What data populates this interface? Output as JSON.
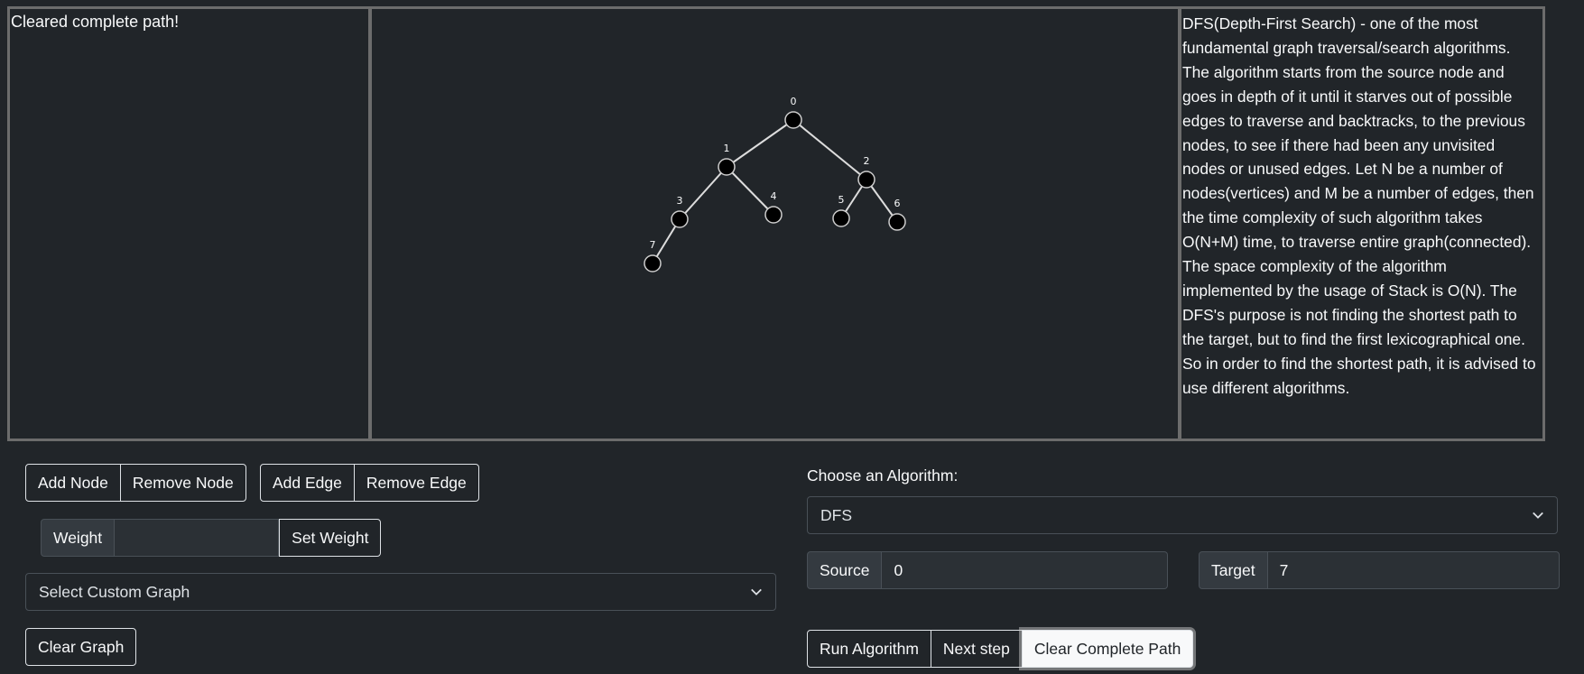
{
  "status": {
    "message": "Cleared complete path!"
  },
  "graph": {
    "nodes": [
      {
        "id": "0",
        "label": "0"
      },
      {
        "id": "1",
        "label": "1"
      },
      {
        "id": "2",
        "label": "2"
      },
      {
        "id": "3",
        "label": "3"
      },
      {
        "id": "4",
        "label": "4"
      },
      {
        "id": "5",
        "label": "5"
      },
      {
        "id": "6",
        "label": "6"
      },
      {
        "id": "7",
        "label": "7"
      }
    ],
    "edges": [
      [
        "0",
        "1"
      ],
      [
        "0",
        "2"
      ],
      [
        "1",
        "3"
      ],
      [
        "1",
        "4"
      ],
      [
        "2",
        "5"
      ],
      [
        "2",
        "6"
      ],
      [
        "3",
        "7"
      ]
    ],
    "node_color": "#000000",
    "edge_color": "#dddddd"
  },
  "description": {
    "text": "DFS(Depth-First Search) - one of the most fundamental graph traversal/search algorithms. The algorithm starts from the source node and goes in depth of it until it starves out of possible edges to traverse and backtracks, to the previous nodes, to see if there had been any unvisited nodes or unused edges. Let N be a number of nodes(vertices) and M be a number of edges, then the time complexity of such algorithm takes O(N+M) time, to traverse entire graph(connected). The space complexity of the algorithm implemented by the usage of Stack is O(N). The DFS's purpose is not finding the shortest path to the target, but to find the first lexicographical one. So in order to find the shortest path, it is advised to use different algorithms."
  },
  "controls": {
    "add_node": "Add Node",
    "remove_node": "Remove Node",
    "add_edge": "Add Edge",
    "remove_edge": "Remove Edge",
    "weight_label": "Weight",
    "weight_value": "",
    "set_weight": "Set Weight",
    "custom_graph_select": "Select Custom Graph",
    "clear_graph": "Clear Graph"
  },
  "algorithm": {
    "choose_label": "Choose an Algorithm:",
    "selected": "DFS",
    "source_label": "Source",
    "source_value": "0",
    "target_label": "Target",
    "target_value": "7",
    "run": "Run Algorithm",
    "next_step": "Next step",
    "clear_path": "Clear Complete Path"
  },
  "colors": {
    "background": "#212529",
    "border": "#6c6c6c",
    "active_button_bg": "#f8f9fa",
    "active_button_text": "#212529"
  }
}
